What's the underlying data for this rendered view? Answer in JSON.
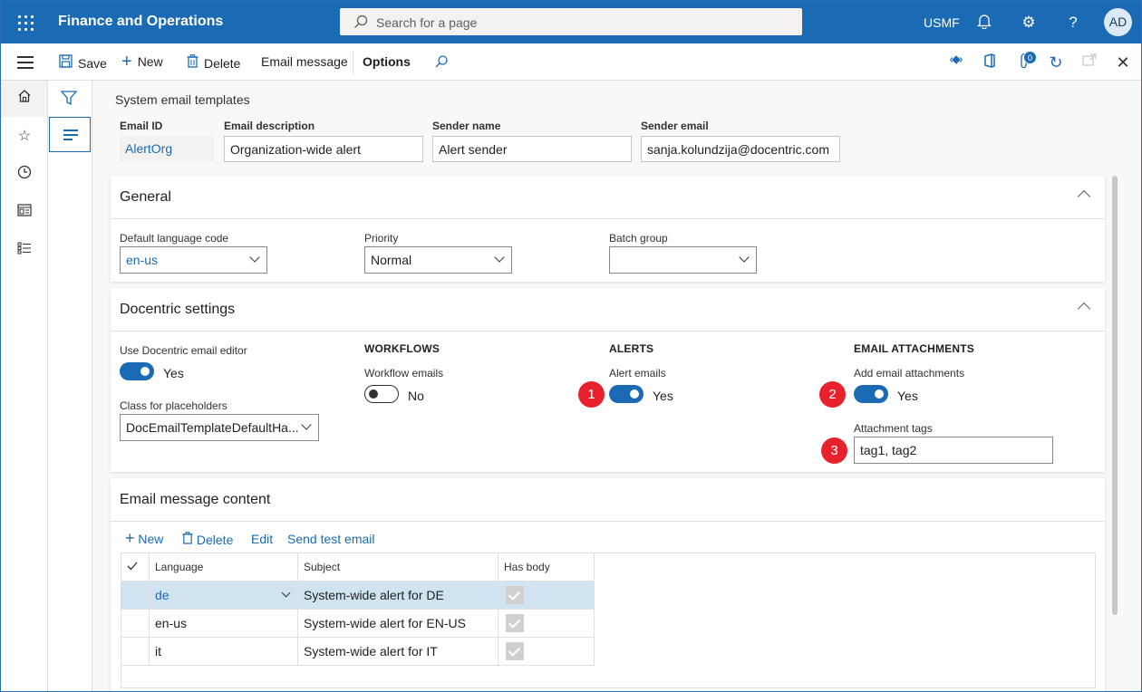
{
  "app": {
    "title": "Finance and Operations",
    "company": "USMF",
    "user_initials": "AD"
  },
  "search": {
    "placeholder": "Search for a page"
  },
  "actions": {
    "save": "Save",
    "new": "New",
    "delete": "Delete",
    "email_message": "Email message",
    "options": "Options"
  },
  "attachments_badge": "0",
  "page": {
    "caption": "System email templates"
  },
  "header": {
    "email_id_label": "Email ID",
    "email_id": "AlertOrg",
    "description_label": "Email description",
    "description": "Organization-wide alert",
    "sender_name_label": "Sender name",
    "sender_name": "Alert sender",
    "sender_email_label": "Sender email",
    "sender_email": "sanja.kolundzija@docentric.com"
  },
  "general": {
    "title": "General",
    "language_label": "Default language code",
    "language": "en-us",
    "priority_label": "Priority",
    "priority": "Normal",
    "batch_label": "Batch group",
    "batch": ""
  },
  "docentric": {
    "title": "Docentric settings",
    "editor_label": "Use Docentric email editor",
    "editor_value": "Yes",
    "class_label": "Class for placeholders",
    "class_value": "DocEmailTemplateDefaultHa...",
    "workflows_title": "WORKFLOWS",
    "workflow_emails_label": "Workflow emails",
    "workflow_emails_value": "No",
    "alerts_title": "ALERTS",
    "alert_emails_label": "Alert emails",
    "alert_emails_value": "Yes",
    "attachments_title": "EMAIL ATTACHMENTS",
    "add_attachments_label": "Add email attachments",
    "add_attachments_value": "Yes",
    "tags_label": "Attachment tags",
    "tags_value": "tag1, tag2",
    "markers": [
      "1",
      "2",
      "3"
    ]
  },
  "content": {
    "title": "Email message content",
    "toolbar": {
      "new": "New",
      "delete": "Delete",
      "edit": "Edit",
      "send_test": "Send test email"
    },
    "columns": [
      "Language",
      "Subject",
      "Has body"
    ],
    "rows": [
      {
        "language": "de",
        "subject": "System-wide alert for DE",
        "has_body": true
      },
      {
        "language": "en-us",
        "subject": "System-wide alert for EN-US",
        "has_body": true
      },
      {
        "language": "it",
        "subject": "System-wide alert for IT",
        "has_body": true
      }
    ]
  }
}
